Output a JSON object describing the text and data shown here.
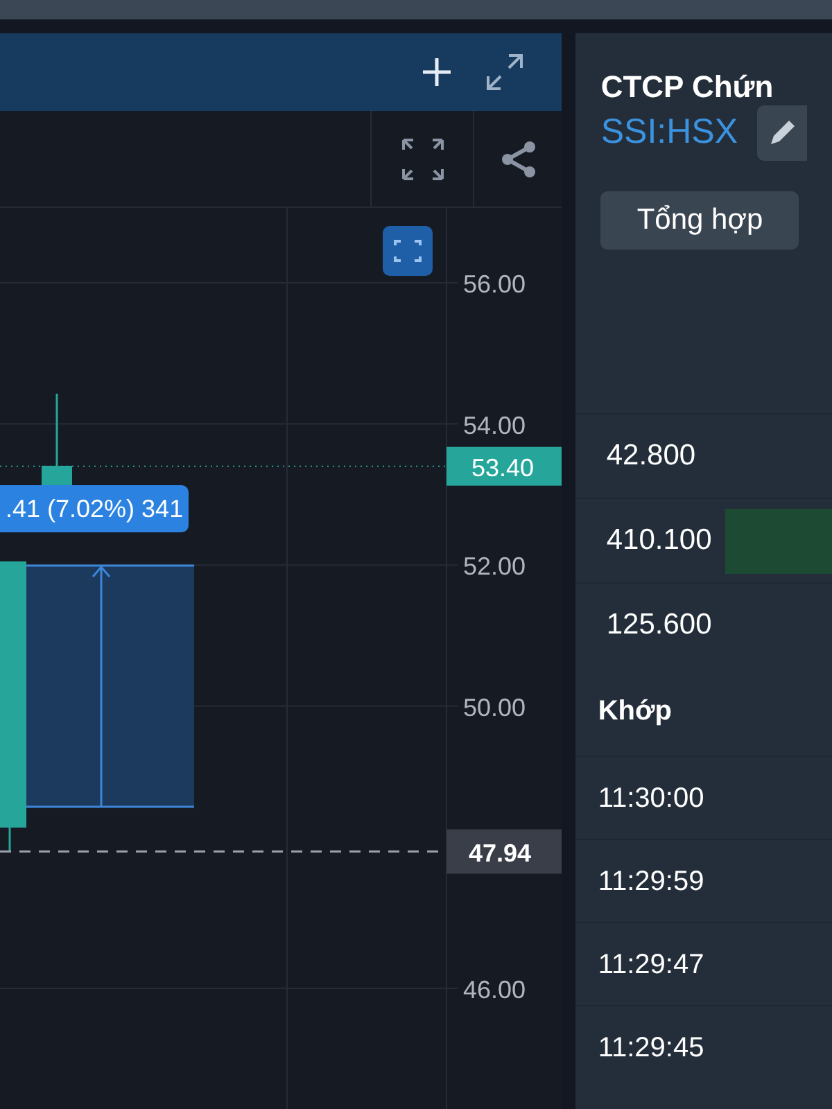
{
  "chart_panel": {
    "price_axis": {
      "ticks": [
        "56.00",
        "54.00",
        "52.00",
        "50.00",
        "46.00"
      ],
      "last_price": "53.40",
      "marker_price": "47.94"
    },
    "tooltip": ".41 (7.02%) 341"
  },
  "info_panel": {
    "title": "CTCP Chứn",
    "symbol": "SSI:HSX",
    "tabs": [
      {
        "label": "Tổng hợp",
        "selected": true
      }
    ],
    "volume_rows": [
      {
        "value": "42.800",
        "bar": false
      },
      {
        "value": "410.100",
        "bar": true
      },
      {
        "value": "125.600",
        "bar": false
      }
    ],
    "match_header": "Khớp",
    "times": [
      "11:30:00",
      "11:29:59",
      "11:29:47",
      "11:29:45"
    ]
  }
}
